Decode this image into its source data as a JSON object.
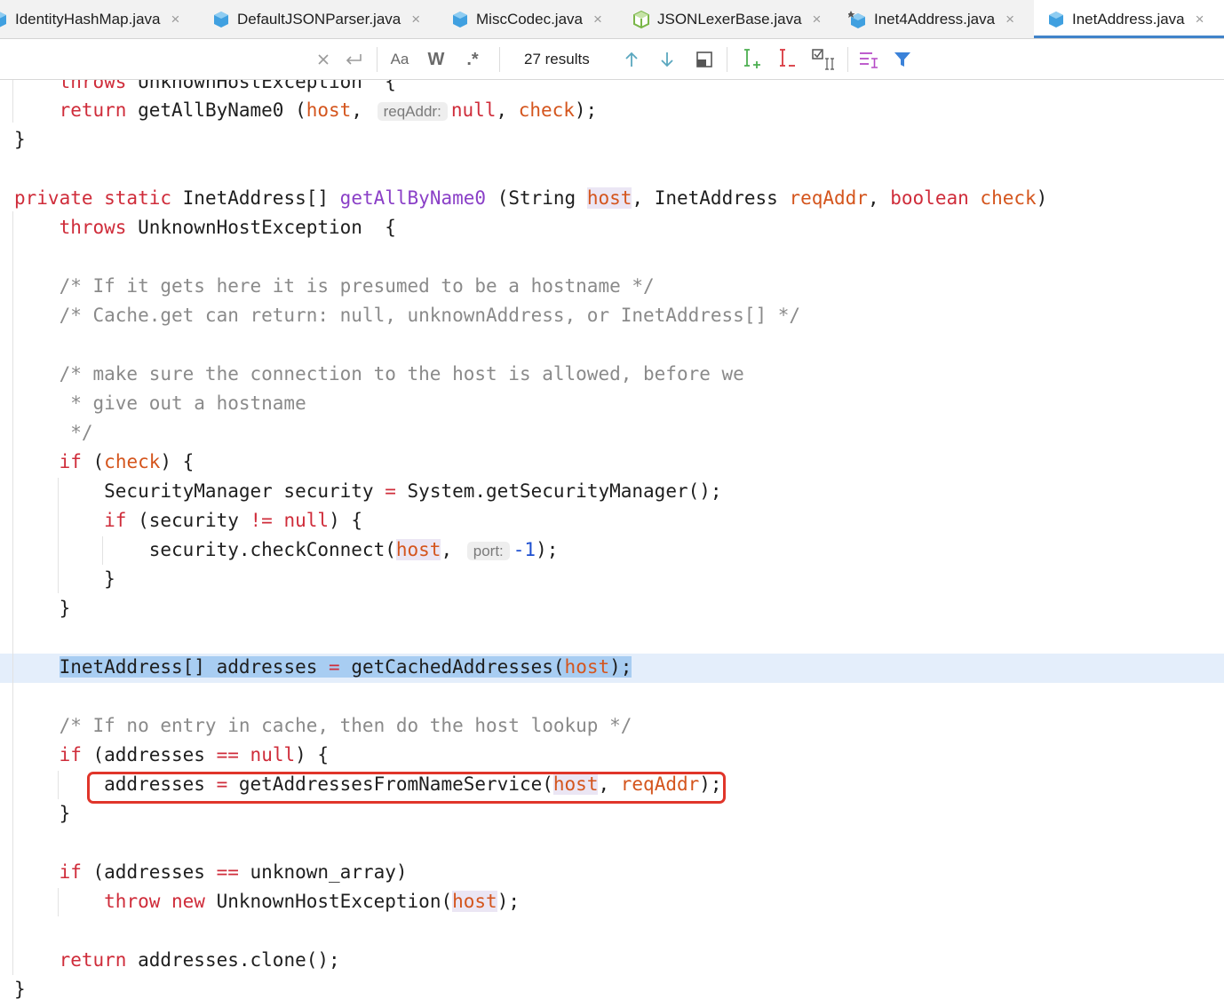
{
  "tabs": [
    {
      "label": "IdentityHashMap.java",
      "icon": "java-class-icon",
      "active": false
    },
    {
      "label": "DefaultJSONParser.java",
      "icon": "java-class-icon",
      "active": false
    },
    {
      "label": "MiscCodec.java",
      "icon": "java-class-icon",
      "active": false
    },
    {
      "label": "JSONLexerBase.java",
      "icon": "java-abstract-class-icon",
      "active": false
    },
    {
      "label": "Inet4Address.java",
      "icon": "java-class-icon",
      "active": false
    },
    {
      "label": "InetAddress.java",
      "icon": "java-class-icon",
      "active": true
    }
  ],
  "tab_close_glyph": "×",
  "search": {
    "results_label": "27 results",
    "match_case_label": "Aa",
    "words_label": "W",
    "regex_label": ".*"
  },
  "editor": {
    "hints": {
      "reqAddr": "reqAddr:",
      "port": "port:"
    },
    "highlight_word": "host"
  },
  "colors": {
    "keyword": "#cf2c3a",
    "parameter": "#d4551d",
    "method": "#8a3fc7",
    "comment": "#8a8a8a",
    "selection": "#a8cdf2",
    "annotation_box": "#e0352a",
    "active_tab_underline": "#4083c9"
  }
}
